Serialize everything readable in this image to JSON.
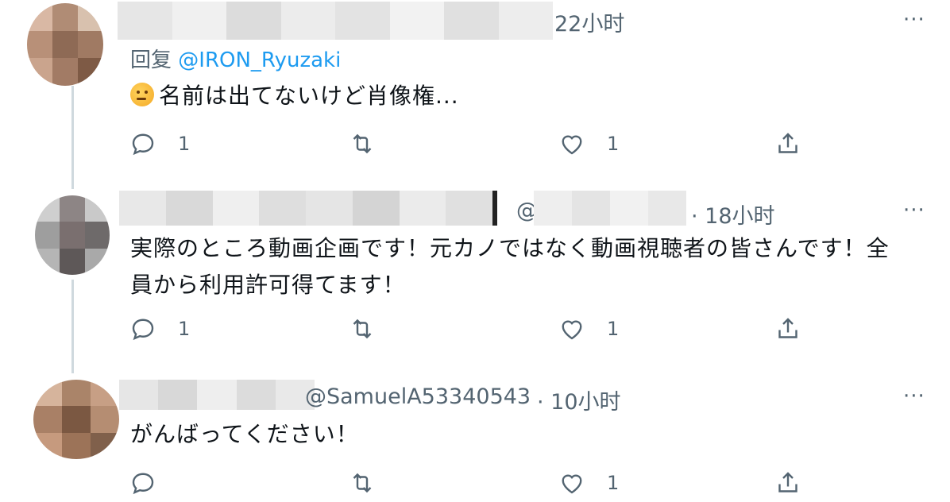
{
  "tweets": [
    {
      "time": "22小时",
      "reply_prefix": "回复",
      "reply_handle": "@IRON_Ryuzaki",
      "text": "名前は出てないけど肖像権...",
      "emoji": "thinking-face",
      "actions": {
        "reply_count": "1",
        "retweet_count": "",
        "like_count": "1"
      }
    },
    {
      "handle": "@",
      "time": "· 18小时",
      "text_lines": [
        "実際のところ動画企画です！元カノではなく動画視聴者の皆さんです！全",
        "員から利用許可得てます！"
      ],
      "actions": {
        "reply_count": "1",
        "retweet_count": "",
        "like_count": "1"
      }
    },
    {
      "handle": "@SamuelA53340543",
      "time": "· 10小时",
      "text": "がんばってください！",
      "actions": {
        "reply_count": "",
        "retweet_count": "",
        "like_count": "1"
      }
    }
  ],
  "more_label": "···",
  "colors": {
    "text": "#0f1419",
    "muted": "#536471",
    "link": "#1d9bf0",
    "thread": "#cfd9de"
  }
}
